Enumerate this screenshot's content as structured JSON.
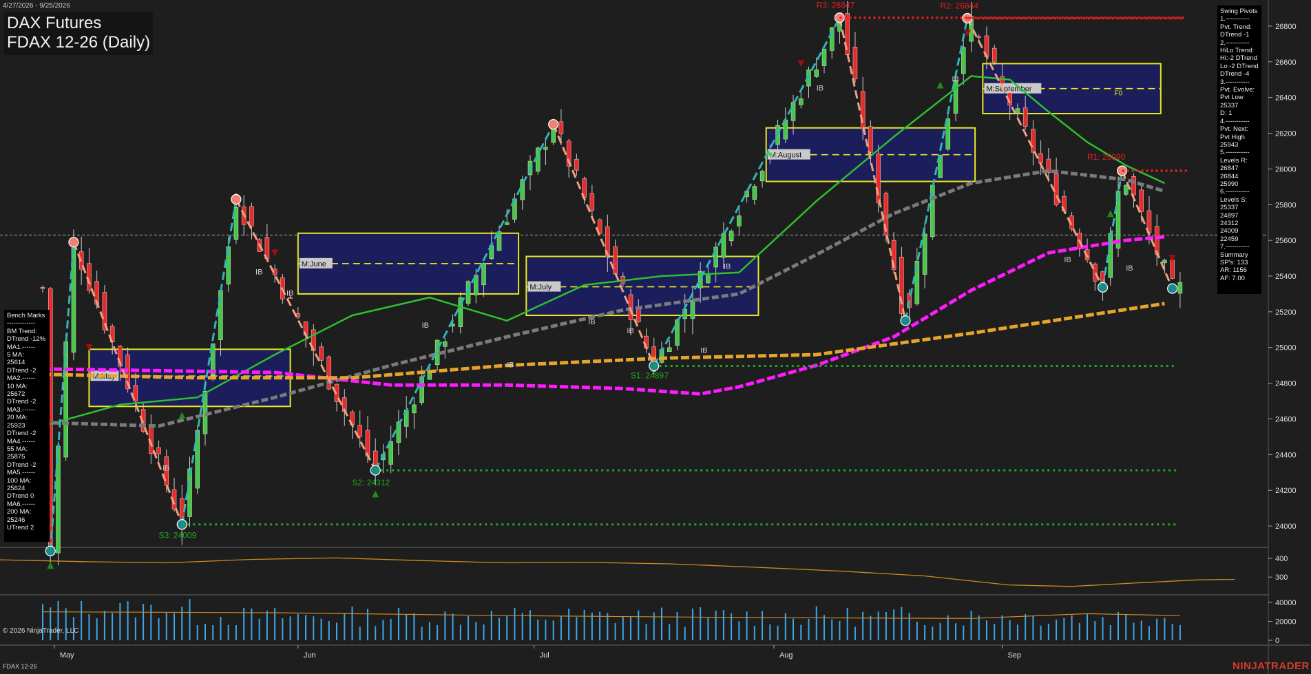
{
  "header": {
    "date_range": "4/27/2026 - 9/25/2026",
    "title_line1": "DAX Futures",
    "title_line2": "FDAX 12-26 (Daily)"
  },
  "footer": {
    "copyright": "© 2026 NinjaTrader, LLC",
    "instrument": "FDAX 12-26",
    "brand": "NINJATRADER"
  },
  "benchmarks": [
    "Bench Marks",
    "-------------",
    "BM Trend:",
    "DTrend -12%",
    "MA1.------",
    "5 MA:",
    "25614",
    "DTrend -2",
    "MA2.------",
    "10 MA:",
    "25672",
    "DTrend -2",
    "MA3.------",
    "20 MA:",
    "25923",
    "DTrend -2",
    "MA4.------",
    "55 MA:",
    "25875",
    "DTrend -2",
    "MA5.------",
    "100 MA:",
    "25624",
    "DTrend 0",
    "MA6.------",
    "200 MA:",
    "25246",
    "UTrend 2"
  ],
  "swing_pivots": [
    "Swing Pivots",
    "1.-----------",
    "Pvt. Trend:",
    "DTrend -1",
    "2.-----------",
    "HiLo Trend:",
    "Hi:-2 DTrend",
    "Lo:-2 DTrend",
    "DTrend -4",
    "3.-----------",
    "Pvt. Evolve:",
    "Pvt Low",
    "25337",
    "D: 1",
    "4.-----------",
    "Pvt. Next:",
    "Pvt High",
    "25943",
    "5.-----------",
    "Levels R:",
    "26847",
    "26844",
    "25990",
    "6.-----------",
    "Levels S:",
    "25337",
    "24897",
    "24312",
    "24009",
    "22459",
    "7.-----------",
    "Summary",
    "SP's: 133",
    "AR: 1156",
    "AF: 7.00"
  ],
  "chart_data": {
    "type": "candlestick",
    "y_axis": {
      "range": [
        23900,
        26900
      ],
      "ticks": [
        24000,
        24200,
        24400,
        24600,
        24800,
        25000,
        25200,
        25400,
        25600,
        25800,
        26000,
        26200,
        26400,
        26600,
        26800
      ]
    },
    "x_axis": {
      "month_labels": [
        "May",
        "Jun",
        "Jul",
        "Aug",
        "Sep"
      ]
    },
    "grid": false,
    "last_price": 25630,
    "levels": [
      {
        "label": "R3: 26847",
        "value": 26847,
        "color": "#e02020",
        "kind": "resistance"
      },
      {
        "label": "R2: 26844",
        "value": 26844,
        "color": "#e02020",
        "kind": "resistance"
      },
      {
        "label": "R1: 25990",
        "value": 25990,
        "color": "#e02020",
        "kind": "resistance"
      },
      {
        "label": "S1: 24897",
        "value": 24897,
        "color": "#22aa22",
        "kind": "support"
      },
      {
        "label": "S2: 24312",
        "value": 24312,
        "color": "#22aa22",
        "kind": "support"
      },
      {
        "label": "S3: 24009",
        "value": 24009,
        "color": "#22aa22",
        "kind": "support"
      }
    ],
    "pivots": [
      {
        "i": 2,
        "value": 23860,
        "kind": "low"
      },
      {
        "i": 8,
        "value": 25590,
        "kind": "high"
      },
      {
        "i": 36,
        "value": 24009,
        "kind": "low"
      },
      {
        "i": 50,
        "value": 25830,
        "kind": "high"
      },
      {
        "i": 86,
        "value": 24312,
        "kind": "low"
      },
      {
        "i": 132,
        "value": 26250,
        "kind": "high"
      },
      {
        "i": 158,
        "value": 24897,
        "kind": "low"
      },
      {
        "i": 206,
        "value": 26847,
        "kind": "high"
      },
      {
        "i": 223,
        "value": 25150,
        "kind": "low"
      },
      {
        "i": 239,
        "value": 26844,
        "kind": "high"
      },
      {
        "i": 274,
        "value": 25337,
        "kind": "low"
      },
      {
        "i": 279,
        "value": 25990,
        "kind": "high"
      },
      {
        "i": 292,
        "value": 25330,
        "kind": "low"
      }
    ],
    "monthly_boxes": [
      {
        "label": "M:May",
        "i_start": 12,
        "i_end": 64,
        "high": 24990,
        "low": 24670,
        "mid": 24840
      },
      {
        "label": "M:June",
        "i_start": 66,
        "i_end": 123,
        "high": 25640,
        "low": 25300,
        "mid": 25470
      },
      {
        "label": "M:July",
        "i_start": 125,
        "i_end": 185,
        "high": 25510,
        "low": 25180,
        "mid": 25340
      },
      {
        "label": "M:August",
        "i_start": 187,
        "i_end": 241,
        "high": 26230,
        "low": 25930,
        "mid": 26080
      },
      {
        "label": "M:September",
        "i_start": 243,
        "i_end": 289,
        "high": 26590,
        "low": 26310,
        "mid": 26450
      }
    ],
    "fib_label": "F0",
    "ib_labels": [
      {
        "i": 31,
        "value": 24310
      },
      {
        "i": 55,
        "value": 25410
      },
      {
        "i": 63,
        "value": 25290
      },
      {
        "i": 98,
        "value": 25110
      },
      {
        "i": 120,
        "value": 24890
      },
      {
        "i": 141,
        "value": 25130
      },
      {
        "i": 151,
        "value": 25080
      },
      {
        "i": 170,
        "value": 24970
      },
      {
        "i": 176,
        "value": 25440
      },
      {
        "i": 200,
        "value": 26440
      },
      {
        "i": 235,
        "value": 26490
      },
      {
        "i": 264,
        "value": 25480
      },
      {
        "i": 280,
        "value": 25430
      }
    ],
    "series": [
      {
        "name": "20 MA",
        "color": "#2ec02e",
        "points": [
          [
            0,
            24560
          ],
          [
            20,
            24680
          ],
          [
            40,
            24720
          ],
          [
            60,
            24960
          ],
          [
            80,
            25180
          ],
          [
            100,
            25280
          ],
          [
            120,
            25150
          ],
          [
            140,
            25350
          ],
          [
            160,
            25400
          ],
          [
            180,
            25420
          ],
          [
            200,
            25820
          ],
          [
            220,
            26180
          ],
          [
            240,
            26520
          ],
          [
            250,
            26500
          ],
          [
            260,
            26320
          ],
          [
            270,
            26150
          ],
          [
            280,
            26020
          ],
          [
            290,
            25920
          ]
        ]
      },
      {
        "name": "55 MA",
        "color": "#7a7a7a",
        "points": [
          [
            0,
            24580
          ],
          [
            30,
            24560
          ],
          [
            60,
            24720
          ],
          [
            90,
            24900
          ],
          [
            120,
            25060
          ],
          [
            150,
            25210
          ],
          [
            180,
            25300
          ],
          [
            200,
            25520
          ],
          [
            220,
            25750
          ],
          [
            240,
            25920
          ],
          [
            260,
            25990
          ],
          [
            280,
            25940
          ],
          [
            290,
            25875
          ]
        ]
      },
      {
        "name": "100 MA",
        "color": "#ff1aff",
        "points": [
          [
            0,
            24880
          ],
          [
            30,
            24870
          ],
          [
            60,
            24860
          ],
          [
            90,
            24790
          ],
          [
            120,
            24790
          ],
          [
            150,
            24770
          ],
          [
            170,
            24740
          ],
          [
            180,
            24780
          ],
          [
            200,
            24900
          ],
          [
            220,
            25060
          ],
          [
            240,
            25320
          ],
          [
            260,
            25530
          ],
          [
            280,
            25600
          ],
          [
            290,
            25620
          ]
        ]
      },
      {
        "name": "200 MA",
        "color": "#e6a52a",
        "points": [
          [
            0,
            24850
          ],
          [
            40,
            24830
          ],
          [
            80,
            24830
          ],
          [
            120,
            24900
          ],
          [
            160,
            24940
          ],
          [
            200,
            24960
          ],
          [
            240,
            25080
          ],
          [
            270,
            25180
          ],
          [
            290,
            25246
          ]
        ]
      }
    ],
    "volatility_panel": {
      "ticks": [
        300,
        400
      ],
      "range": [
        220,
        440
      ]
    },
    "volume_panel": {
      "ticks": [
        0,
        20000,
        40000
      ],
      "range": [
        0,
        45000
      ]
    }
  }
}
